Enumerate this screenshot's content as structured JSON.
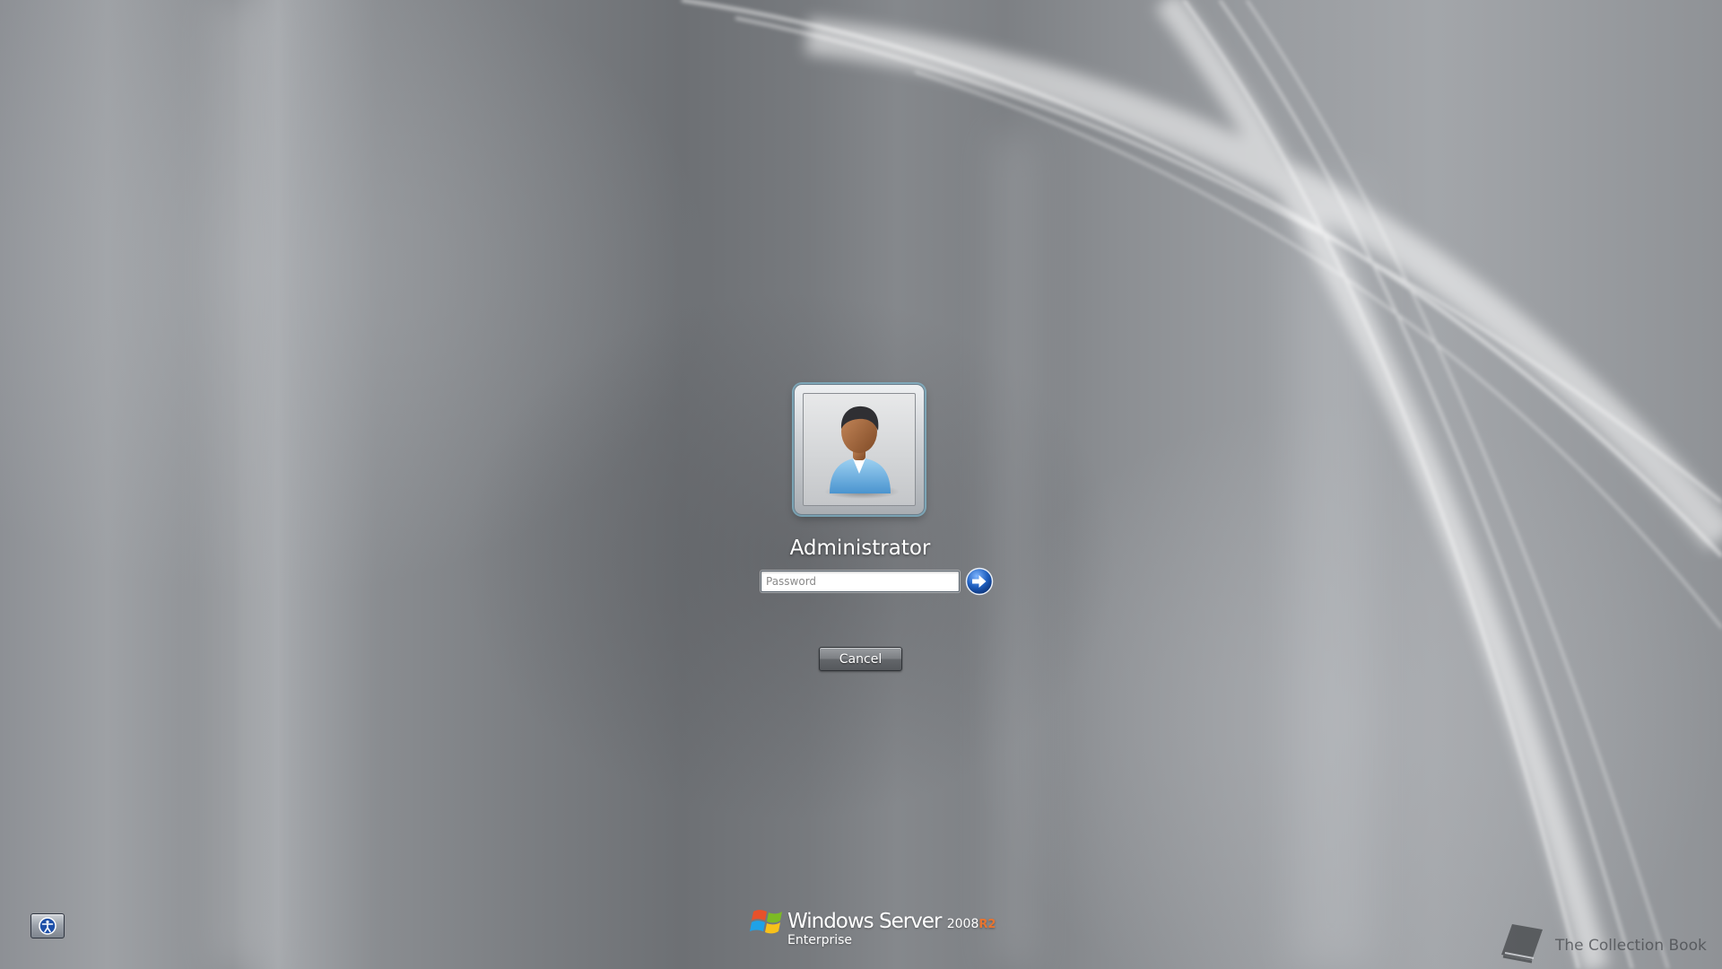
{
  "login": {
    "username": "Administrator",
    "password_value": "",
    "password_placeholder": "Password",
    "cancel_label": "Cancel"
  },
  "branding": {
    "windows": "Windows",
    "server": "Server",
    "version": "2008",
    "release": "R2",
    "edition": "Enterprise"
  },
  "watermark": {
    "text": "The Collection Book"
  },
  "icons": {
    "user_tile": "user-avatar-icon",
    "submit": "arrow-right-icon",
    "ease_of_access": "ease-of-access-icon",
    "logo": "windows-flag-icon",
    "watermark": "book-icon"
  },
  "colors": {
    "background": "#8a8d91",
    "submit_blue": "#1f5fbf",
    "release_orange": "#e8742f"
  }
}
